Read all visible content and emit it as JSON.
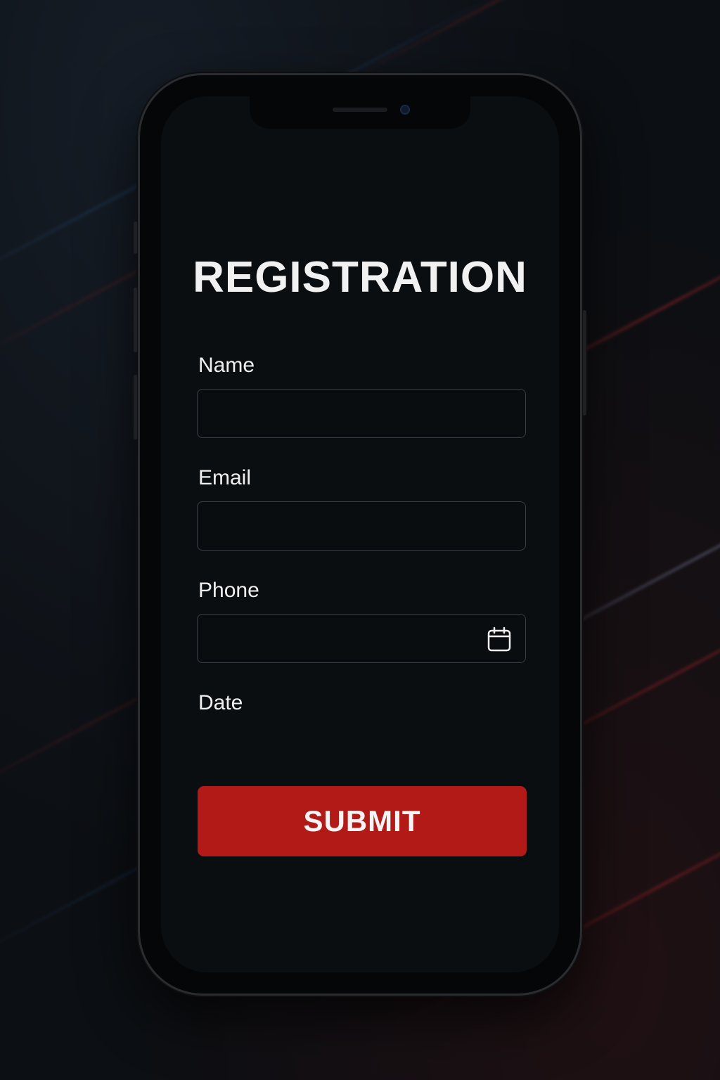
{
  "form": {
    "title": "REGISTRATION",
    "fields": [
      {
        "label": "Name",
        "value": "",
        "placeholder": ""
      },
      {
        "label": "Email",
        "value": "",
        "placeholder": ""
      },
      {
        "label": "Phone",
        "value": "",
        "placeholder": "",
        "icon": "calendar-icon"
      },
      {
        "label": "Date"
      }
    ],
    "submit_label": "SUBMIT"
  },
  "colors": {
    "background": "#0c0f13",
    "screen": "#0b0e11",
    "accent": "#b21a17",
    "text": "#f1f1f1",
    "field_border": "#3a3e44"
  }
}
